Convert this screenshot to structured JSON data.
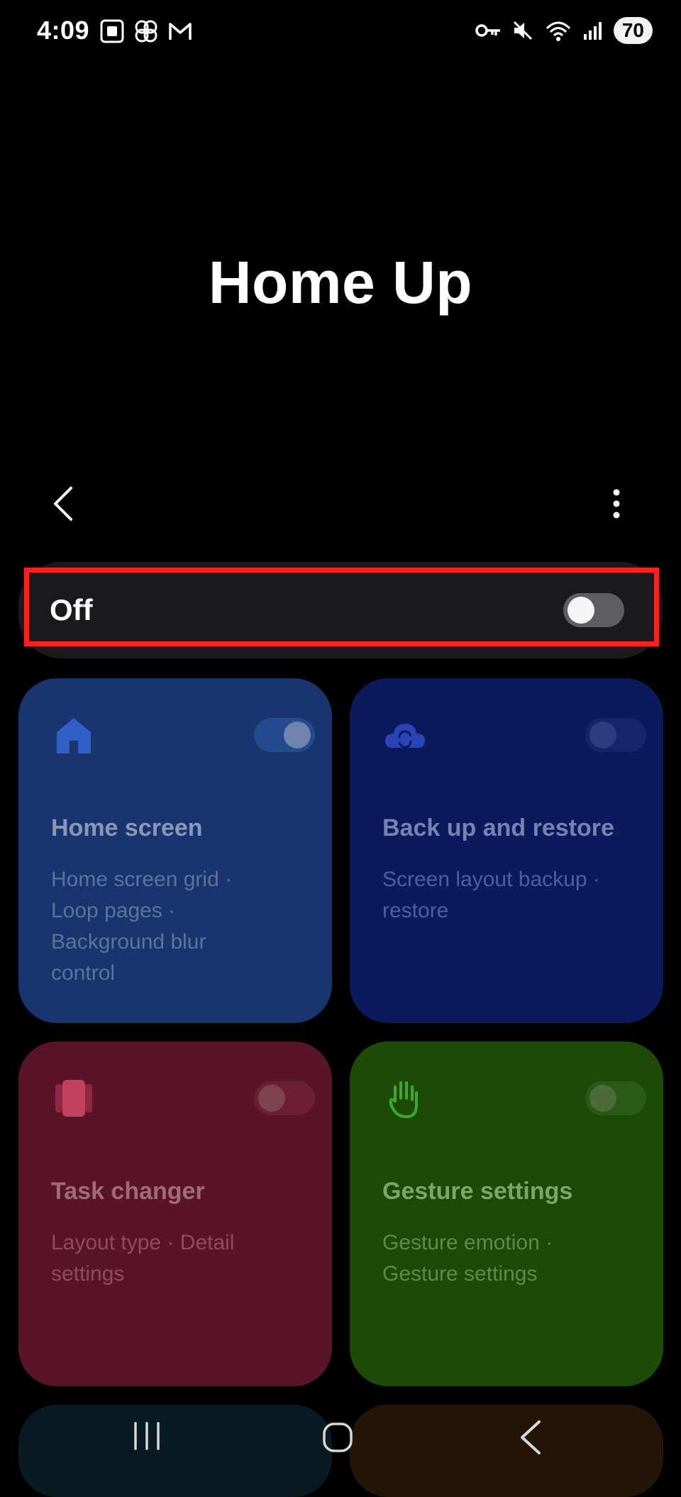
{
  "status_bar": {
    "time": "4:09",
    "battery": "70",
    "left_icons": [
      "screenshot-icon",
      "pinwheel-icon",
      "gmail-icon"
    ],
    "right_icons": [
      "vpn-key-icon",
      "mute-icon",
      "wifi-icon",
      "signal-icon"
    ]
  },
  "header": {
    "title": "Home Up"
  },
  "master_switch": {
    "label": "Off",
    "state": "off"
  },
  "cards": [
    {
      "id": "home-screen",
      "title": "Home screen",
      "description": "Home screen grid · Loop pages · Background blur control",
      "icon": "home-icon",
      "color": "#1a3470"
    },
    {
      "id": "back-up-restore",
      "title": "Back up and restore",
      "description": "Screen layout backup · restore",
      "icon": "cloud-sync-icon",
      "color": "#0b1a5c"
    },
    {
      "id": "task-changer",
      "title": "Task changer",
      "description": "Layout type · Detail settings",
      "icon": "task-changer-icon",
      "color": "#5a1429"
    },
    {
      "id": "gesture-settings",
      "title": "Gesture settings",
      "description": "Gesture emotion · Gesture settings",
      "icon": "hand-icon",
      "color": "#1e4a08"
    }
  ],
  "colors": {
    "background": "#000000",
    "highlight": "#ff1f1f",
    "master_row": "#1a1a1c"
  }
}
